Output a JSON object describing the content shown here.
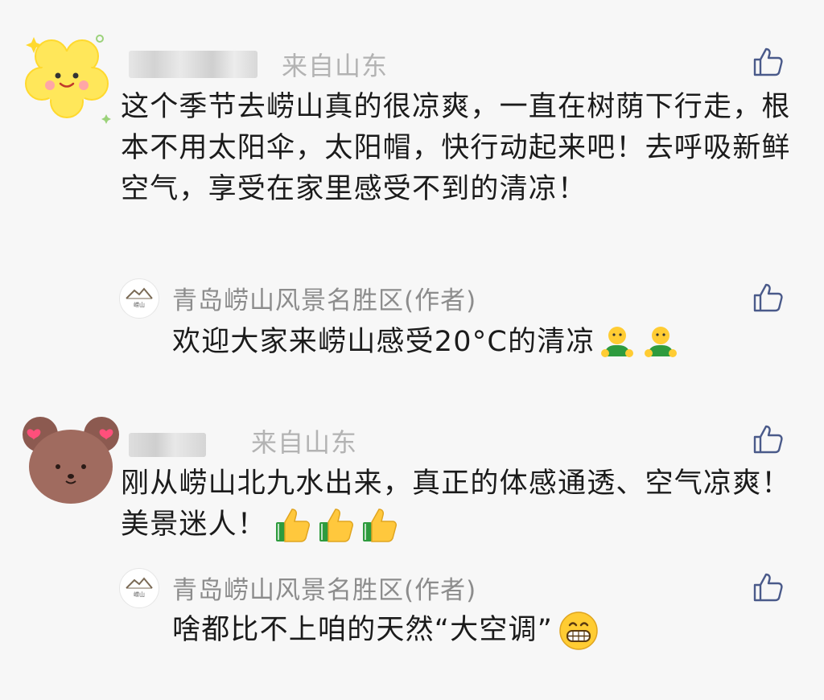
{
  "comments": [
    {
      "location": "来自山东",
      "text": "这个季节去崂山真的很凉爽，一直在树荫下行走，根本不用太阳伞，太阳帽，快行动起来吧！去呼吸新鲜空气，享受在家里感受不到的清凉！",
      "reply": {
        "author": "青岛崂山风景名胜区(作者)",
        "text": "欢迎大家来崂山感受20°C的清凉",
        "emojis": [
          "person-green-emoji",
          "person-green-emoji"
        ]
      }
    },
    {
      "location": "来自山东",
      "text": "刚从崂山北九水出来，真正的体感通透、空气凉爽！美景迷人！",
      "emojis": [
        "thumbs-up-emoji",
        "thumbs-up-emoji",
        "thumbs-up-emoji"
      ],
      "reply": {
        "author": "青岛崂山风景名胜区(作者)",
        "text": "啥都比不上咱的天然“大空调”",
        "emojis": [
          "grin-emoji"
        ]
      }
    }
  ],
  "logo_text": "崂山",
  "colors": {
    "background": "#f7f7f7",
    "location": "#b3b3b3",
    "author": "#8c8c8c",
    "like_icon": "#4a5a8a"
  }
}
